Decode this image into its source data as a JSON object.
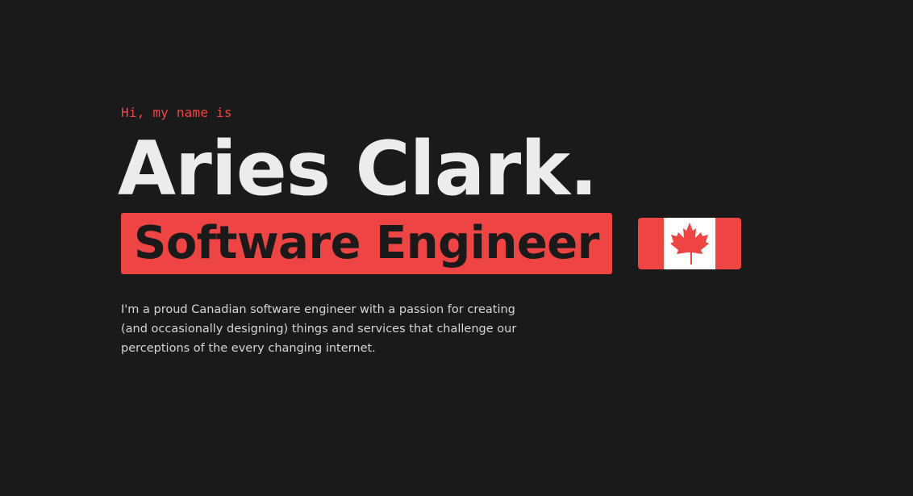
{
  "hero": {
    "greeting": "Hi, my name is",
    "name": "Aries Clark.",
    "role": "Software Engineer",
    "flag_icon": "canada-flag-icon",
    "bio": "I'm a proud Canadian software engineer with a passion for creating (and occasionally designing) things and services that challenge our perceptions of the every changing internet."
  },
  "colors": {
    "background": "#1b1a1b",
    "accent": "#ef4444",
    "heading": "#ececec",
    "body_text": "#d6d6d6"
  }
}
